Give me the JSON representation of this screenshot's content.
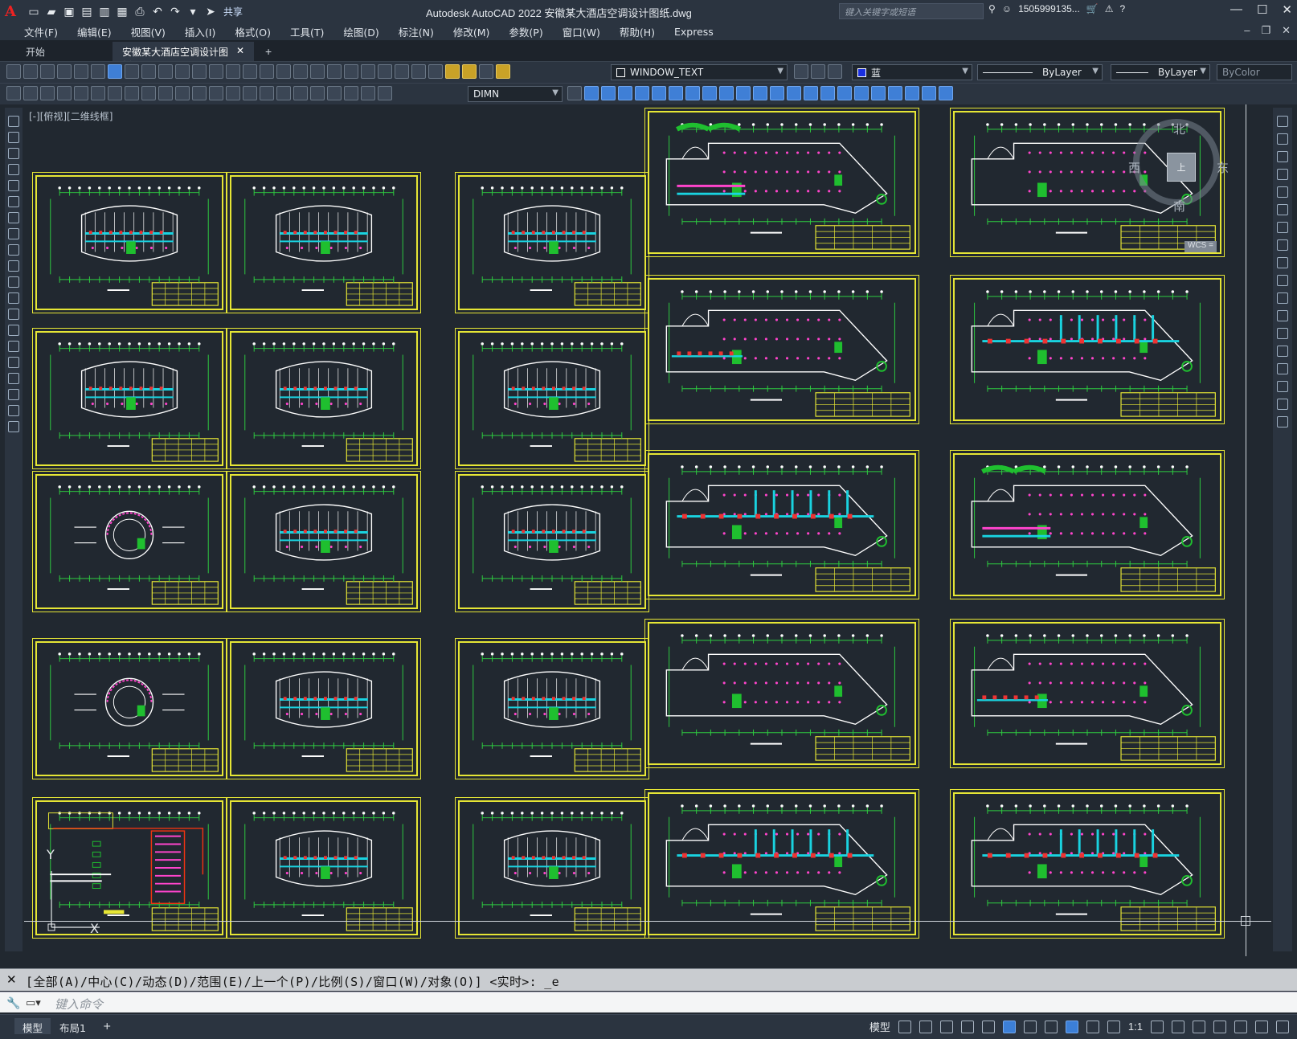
{
  "window": {
    "title": "Autodesk AutoCAD 2022    安徽某大酒店空调设计图纸.dwg",
    "share": "共享",
    "search_placeholder": "键入关键字或短语",
    "user": "1505999135...",
    "logo": "A"
  },
  "menu": [
    "文件(F)",
    "编辑(E)",
    "视图(V)",
    "插入(I)",
    "格式(O)",
    "工具(T)",
    "绘图(D)",
    "标注(N)",
    "修改(M)",
    "参数(P)",
    "窗口(W)",
    "帮助(H)",
    "Express"
  ],
  "tabs": {
    "start": "开始",
    "active": "安徽某大酒店空调设计图纸*",
    "close": "✕",
    "plus": "+"
  },
  "toolbar": {
    "layer": "WINDOW_TEXT",
    "color": "蓝",
    "linetype": "ByLayer",
    "lineweight": "ByLayer",
    "plotstyle": "ByColor",
    "dimstyle": "DIMN"
  },
  "canvas": {
    "view_label": "[-][俯视][二维线框]",
    "viewcube": {
      "north": "北",
      "south": "南",
      "east": "东",
      "west": "西",
      "top": "上",
      "wcs": "WCS ="
    },
    "ucs_x": "X",
    "ucs_y": "Y"
  },
  "command": {
    "history": "[全部(A)/中心(C)/动态(D)/范围(E)/上一个(P)/比例(S)/窗口(W)/对象(O)] <实时>: _e",
    "placeholder": "键入命令"
  },
  "status": {
    "model_tab": "模型",
    "layout_tab": "布局1",
    "add": "+",
    "model_space": "模型",
    "scale": "1:1"
  },
  "colors": {
    "sheet_border": "#e6e635",
    "bg": "#212830",
    "accent": "#3c7fd7"
  }
}
